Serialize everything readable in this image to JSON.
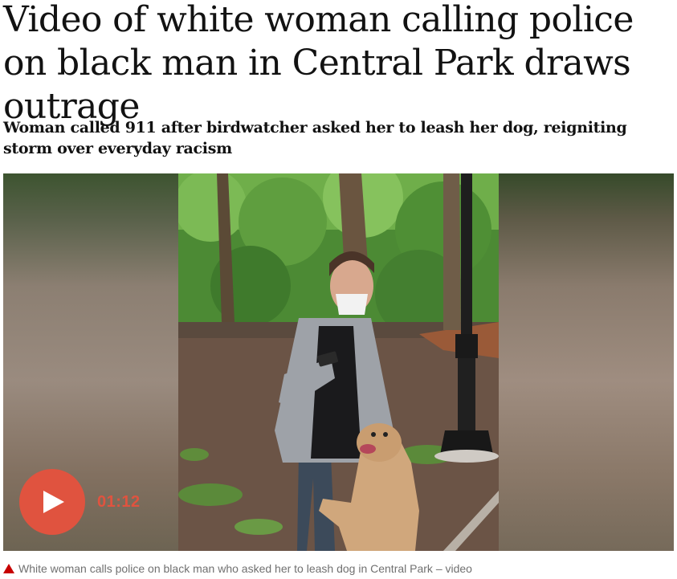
{
  "article": {
    "headline": "Video of white woman calling police on black man in Central Park draws outrage",
    "standfirst": "Woman called 911 after birdwatcher asked her to leash her dog, reigniting storm over everyday racism"
  },
  "video": {
    "duration": "01:12",
    "play_icon": "play-icon",
    "accent_color": "#e0533f"
  },
  "caption": {
    "icon": "triangle-icon",
    "text": "White woman calls police on black man who asked her to leash dog in Central Park – video"
  }
}
